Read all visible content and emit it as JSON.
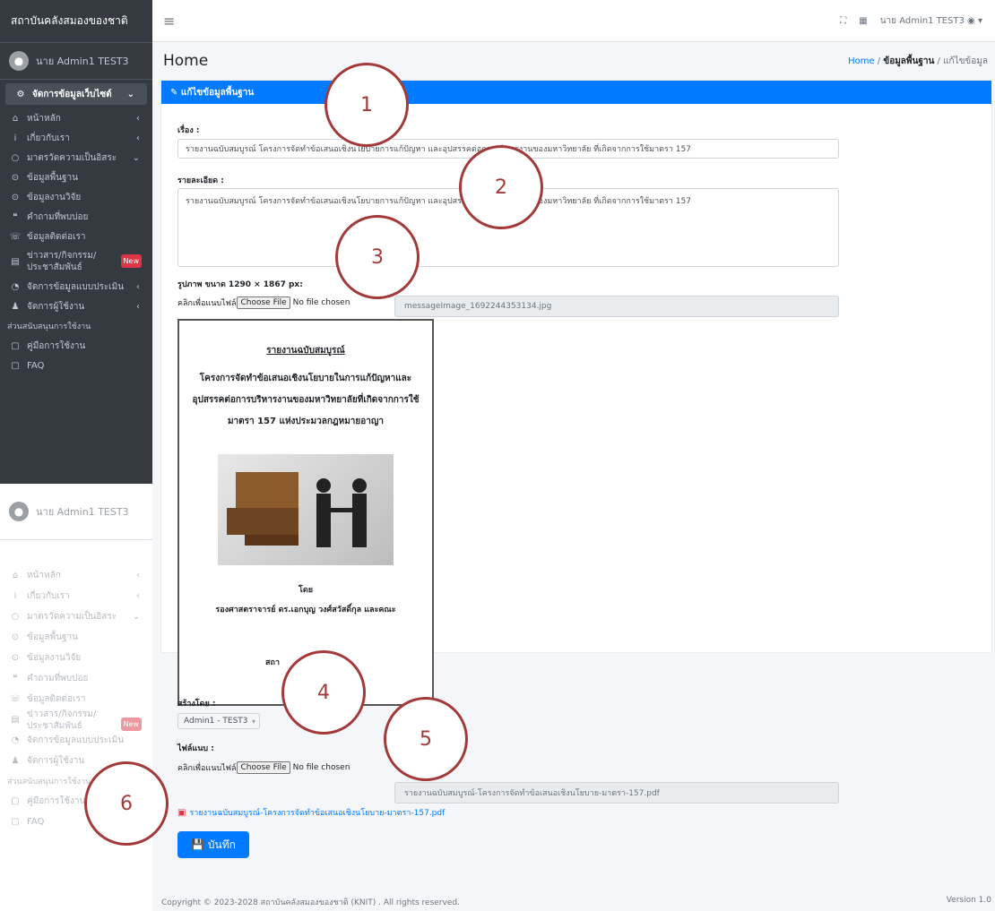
{
  "sidebar": {
    "brand": "สถาบันคลังสมองของชาติ",
    "user": "นาย Admin1 TEST3",
    "items": [
      {
        "label": "จัดการข้อมูลเว็บไซต์",
        "icon": "cogs-icon",
        "arrow": "⌄"
      },
      {
        "label": "หน้าหลัก",
        "icon": "home-icon",
        "arrow": "‹"
      },
      {
        "label": "เกี่ยวกับเรา",
        "icon": "info-icon",
        "arrow": "‹"
      },
      {
        "label": "มาตรวัดความเป็นอิสระ",
        "icon": "circle-icon",
        "arrow": "⌄"
      },
      {
        "label": "ข้อมูลพื้นฐาน",
        "icon": "dot-circle-icon",
        "arrow": ""
      },
      {
        "label": "ข้อมูลงานวิจัย",
        "icon": "dot-circle-icon",
        "arrow": ""
      },
      {
        "label": "คำถามที่พบบ่อย",
        "icon": "comments-icon",
        "arrow": ""
      },
      {
        "label": "ข้อมูลติดต่อเรา",
        "icon": "phone-icon",
        "arrow": ""
      },
      {
        "label": "ข่าวสาร/กิจกรรม/ประชาสัมพันธ์",
        "icon": "newspaper-icon",
        "arrow": "",
        "badge": "New"
      },
      {
        "label": "จัดการข้อมูลแบบประเมิน",
        "icon": "tachometer-icon",
        "arrow": "‹"
      },
      {
        "label": "จัดการผู้ใช้งาน",
        "icon": "user-icon",
        "arrow": "‹"
      }
    ],
    "section": "ส่วนสนับสนุนการใช้งาน",
    "support": [
      {
        "label": "คู่มือการใช้งาน",
        "icon": "file-icon"
      },
      {
        "label": "FAQ",
        "icon": "file-icon"
      }
    ]
  },
  "topbar": {
    "user": "นาย Admin1 TEST3"
  },
  "page": {
    "title": "Home",
    "crumb_home": "Home",
    "crumb_mid": "ข้อมูลพื้นฐาน",
    "crumb_last": "แก้ไขข้อมูล"
  },
  "card": {
    "header": "แก้ไขข้อมูลพื้นฐาน"
  },
  "form": {
    "title_label": "เรื่อง :",
    "title_value": "รายงานฉบับสมบูรณ์ โครงการจัดทำข้อเสนอเชิงนโยบายการแก้ปัญหา และอุปสรรคต่อการบริหารงานของมหาวิทยาลัย ที่เกิดจากการใช้มาตรา 157",
    "detail_label": "รายละเอียด :",
    "detail_value": "รายงานฉบับสมบูรณ์ โครงการจัดทำข้อเสนอเชิงนโยบายการแก้ปัญหา และอุปสรรคต่อการบริหารงานของมหาวิทยาลัย ที่เกิดจากการใช้มาตรา 157",
    "image_label": "รูปภาพ ขนาด 1290 × 1867 px:",
    "attach_text": "คลิกเพื่อแนบไฟล์",
    "choose_file": "Choose File",
    "no_file": "No file chosen",
    "image_name": "messageImage_1692244353134.jpg",
    "created_label": "สร้างโดย :",
    "created_value": "Admin1 - TEST3",
    "file_label": "ไฟล์แนบ :",
    "pdf_name": "รายงานฉบับสมบูรณ์-โครงการจัดทำข้อเสนอเชิงนโยบาย-มาตรา-157.pdf",
    "save": "บันทึก"
  },
  "preview": {
    "heading": "รายงานฉบับสมบูรณ์",
    "title": "โครงการจัดทำข้อเสนอเชิงนโยบายในการแก้ปัญหาและอุปสรรคต่อการบริหารงานของมหาวิทยาลัยที่เกิดจากการใช้มาตรา 157 แห่งประมวลกฎหมายอาญา",
    "by": "โดย",
    "author": "รองศาสตราจารย์ ดร.เอกบุญ วงศ์สวัสดิ์กุล และคณะ",
    "org": "สถา"
  },
  "footer": {
    "copyright": "Copyright © 2023-2028 สถาบันคลังสมองของชาติ (KNIT) . All rights reserved.",
    "version": "Version 1.0"
  },
  "callouts": [
    "1",
    "2",
    "3",
    "4",
    "5",
    "6"
  ]
}
